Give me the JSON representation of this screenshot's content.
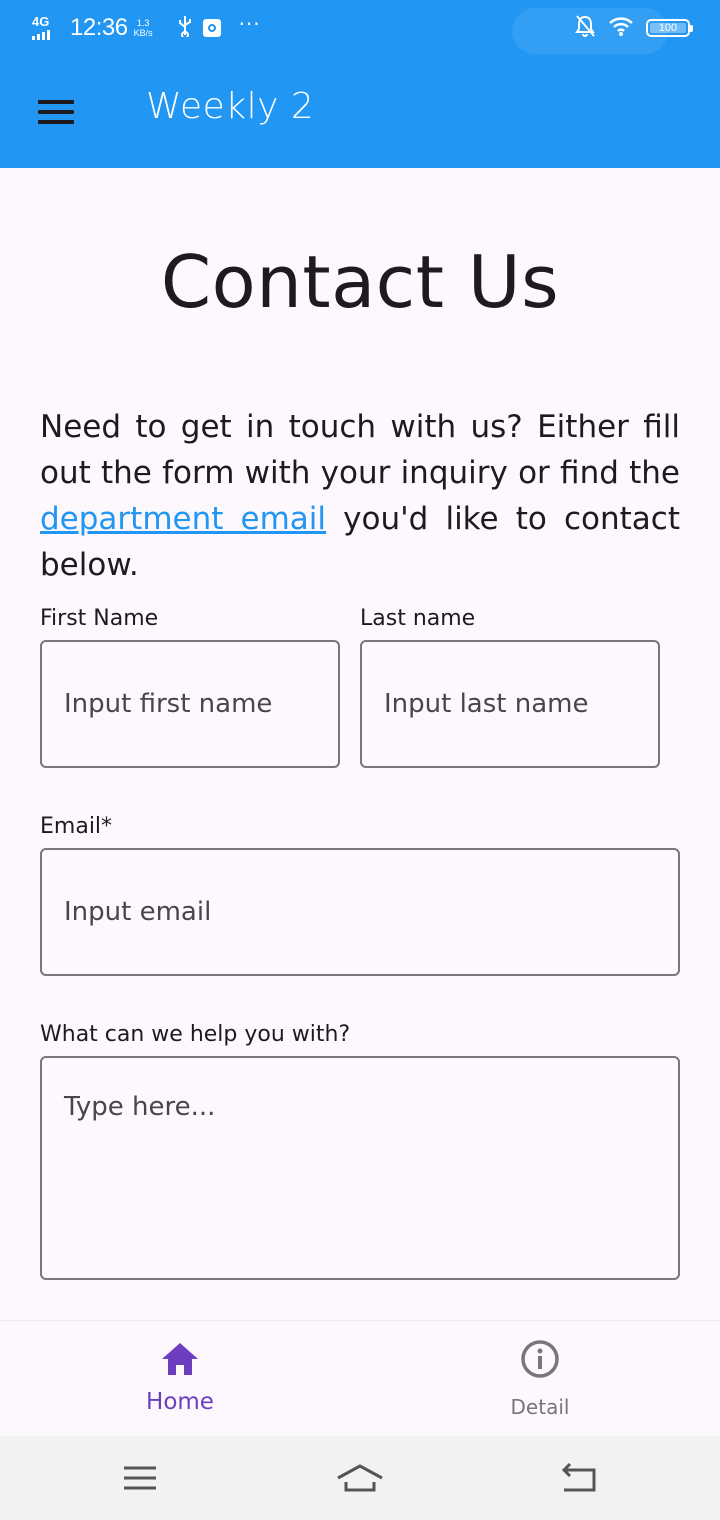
{
  "status_bar": {
    "network": "4G",
    "time": "12:36",
    "speed_value": "1.3",
    "speed_unit": "KB/s",
    "more": "···",
    "battery": "100"
  },
  "app_bar": {
    "title": "Weekly 2"
  },
  "content": {
    "title": "Contact Us",
    "intro_before": "Need to get in touch with us? Either fill out the form with your inquiry or find the ",
    "intro_link": "department email",
    "intro_after": " you'd like to contact below."
  },
  "form": {
    "first_name": {
      "label": "First Name",
      "placeholder": "Input first name",
      "value": ""
    },
    "last_name": {
      "label": "Last name",
      "placeholder": "Input last name",
      "value": ""
    },
    "email": {
      "label": "Email*",
      "placeholder": "Input email",
      "value": ""
    },
    "message": {
      "label": "What can we help you with?",
      "placeholder": "Type here...",
      "value": ""
    }
  },
  "bottom_nav": {
    "items": [
      {
        "label": "Home",
        "icon": "home-icon",
        "active": true
      },
      {
        "label": "Detail",
        "icon": "info-icon",
        "active": false
      }
    ]
  },
  "colors": {
    "primary": "#2196f3",
    "active_nav": "#6d3fc0",
    "background": "#fdf8fd",
    "outline": "#79747e"
  }
}
